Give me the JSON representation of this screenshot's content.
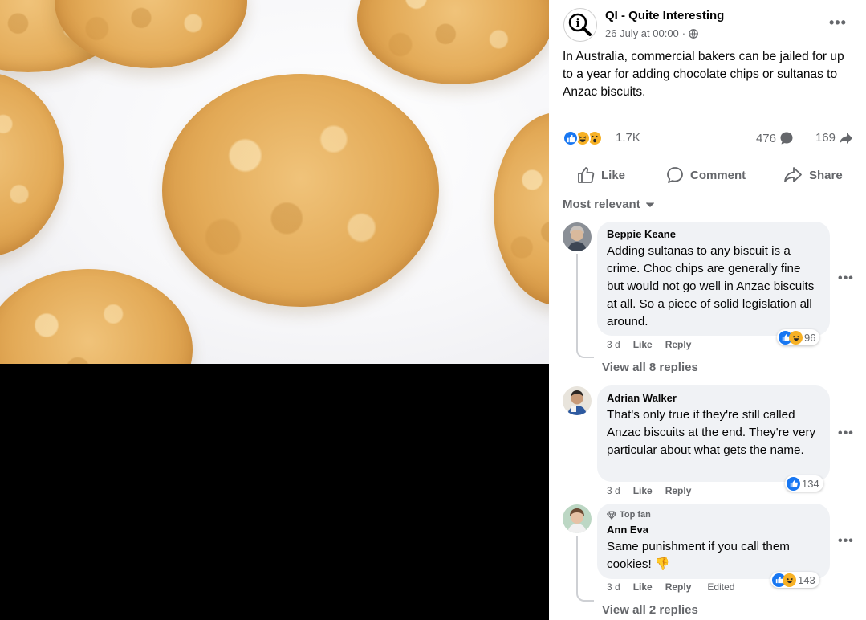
{
  "post": {
    "page_name": "QI - Quite Interesting",
    "date": "26 July at 00:00",
    "date_separator": "·",
    "text": "In Australia, commercial bakers can be jailed for up to a year for adding chocolate chips or sultanas to Anzac biscuits.",
    "reaction_count": "1.7K",
    "comment_count": "476",
    "share_count": "169"
  },
  "actions": {
    "like": "Like",
    "comment": "Comment",
    "share": "Share"
  },
  "sort_label": "Most relevant",
  "comments": [
    {
      "author": "Beppie Keane",
      "text": "Adding sultanas to any biscuit is a crime. Choc chips are generally fine but would not go well in Anzac biscuits at all. So a piece of solid legislation all around.",
      "time": "3 d",
      "like": "Like",
      "reply": "Reply",
      "reactions": "96",
      "view_replies": "View all 8 replies"
    },
    {
      "author": "Adrian Walker",
      "text": "That's only true if they're still called Anzac biscuits at the end. They're very particular about what gets the name.",
      "time": "3 d",
      "like": "Like",
      "reply": "Reply",
      "reactions": "134"
    },
    {
      "badge": "Top fan",
      "author": "Ann Eva",
      "text": "Same punishment if you call them cookies! 👎",
      "time": "3 d",
      "like": "Like",
      "reply": "Reply",
      "edited": "Edited",
      "reactions": "143",
      "view_replies": "View all 2 replies"
    }
  ],
  "colors": {
    "facebook_blue": "#1877f2",
    "secondary_text": "#65676b",
    "bubble_bg": "#f0f2f5",
    "reaction_yellow": "#f7b125"
  },
  "icons": [
    "more-icon",
    "globe-icon",
    "like-icon",
    "comment-icon",
    "share-icon",
    "chevron-down-icon",
    "diamond-icon",
    "thumbs-down-emoji"
  ]
}
